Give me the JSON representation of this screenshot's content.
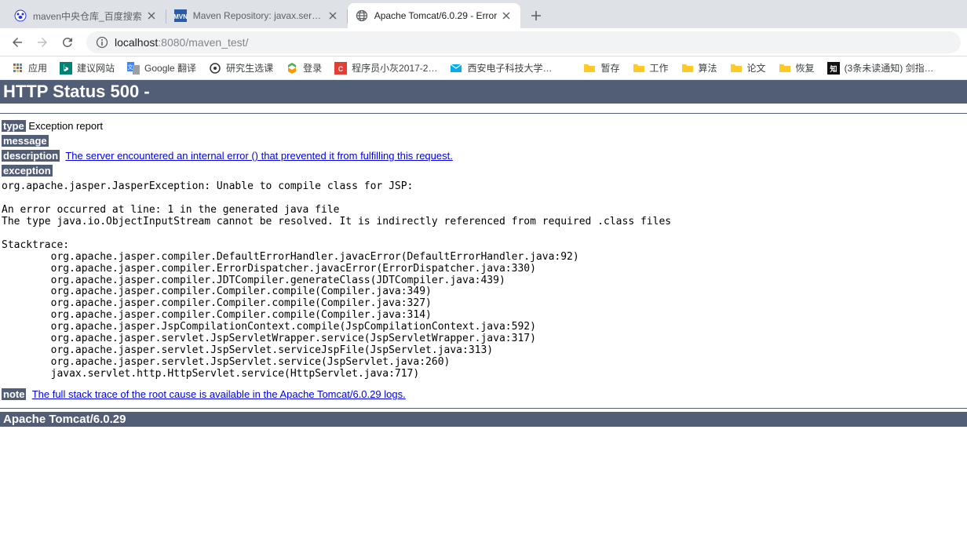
{
  "tabs": [
    {
      "title": "maven中央仓库_百度搜索",
      "favicon": "baidu"
    },
    {
      "title": "Maven Repository: javax.servle",
      "favicon": "mvn"
    },
    {
      "title": "Apache Tomcat/6.0.29 - Error",
      "favicon": "globe",
      "active": true
    }
  ],
  "address": {
    "host": "localhost",
    "port": ":8080",
    "path": "/maven_test/"
  },
  "bookmarks": {
    "apps": "应用",
    "items": [
      {
        "icon": "bing",
        "label": "建议网站"
      },
      {
        "icon": "gtrans",
        "label": "Google 翻译"
      },
      {
        "icon": "circle",
        "label": "研究生选课"
      },
      {
        "icon": "diamond",
        "label": "登录"
      },
      {
        "icon": "csdn",
        "label": "程序员小灰2017-2…"
      },
      {
        "icon": "mail",
        "label": "西安电子科技大学…"
      },
      {
        "icon": "folder",
        "label": "暂存"
      },
      {
        "icon": "folder",
        "label": "工作"
      },
      {
        "icon": "folder",
        "label": "算法"
      },
      {
        "icon": "folder",
        "label": "论文"
      },
      {
        "icon": "folder",
        "label": "恢复"
      },
      {
        "icon": "black",
        "label": "(3条未读通知) 剑指…"
      }
    ]
  },
  "error": {
    "status_title": "HTTP Status 500 -",
    "type_label": "type",
    "type_value": " Exception report",
    "message_label": "message",
    "description_label": "description",
    "description_value": "The server encountered an internal error () that prevented it from fulfilling this request.",
    "exception_label": "exception",
    "stacktrace": "org.apache.jasper.JasperException: Unable to compile class for JSP:\n\nAn error occurred at line: 1 in the generated java file\nThe type java.io.ObjectInputStream cannot be resolved. It is indirectly referenced from required .class files\n\nStacktrace:\n        org.apache.jasper.compiler.DefaultErrorHandler.javacError(DefaultErrorHandler.java:92)\n        org.apache.jasper.compiler.ErrorDispatcher.javacError(ErrorDispatcher.java:330)\n        org.apache.jasper.compiler.JDTCompiler.generateClass(JDTCompiler.java:439)\n        org.apache.jasper.compiler.Compiler.compile(Compiler.java:349)\n        org.apache.jasper.compiler.Compiler.compile(Compiler.java:327)\n        org.apache.jasper.compiler.Compiler.compile(Compiler.java:314)\n        org.apache.jasper.JspCompilationContext.compile(JspCompilationContext.java:592)\n        org.apache.jasper.servlet.JspServletWrapper.service(JspServletWrapper.java:317)\n        org.apache.jasper.servlet.JspServlet.serviceJspFile(JspServlet.java:313)\n        org.apache.jasper.servlet.JspServlet.service(JspServlet.java:260)\n        javax.servlet.http.HttpServlet.service(HttpServlet.java:717)",
    "note_label": "note",
    "note_value": "The full stack trace of the root cause is available in the Apache Tomcat/6.0.29 logs.",
    "footer": "Apache Tomcat/6.0.29"
  }
}
